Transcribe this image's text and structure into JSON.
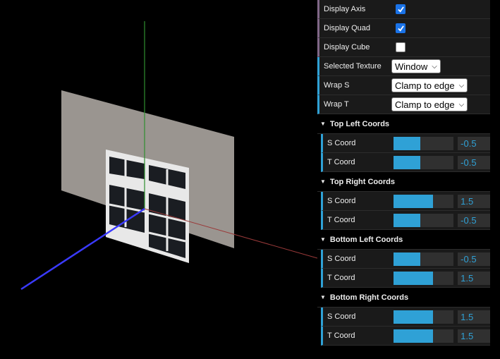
{
  "gui": {
    "controls": [
      {
        "label": "Display Axis",
        "checked": true
      },
      {
        "label": "Display Quad",
        "checked": true
      },
      {
        "label": "Display Cube",
        "checked": false
      }
    ],
    "selected_texture": {
      "label": "Selected Texture",
      "value": "Window"
    },
    "wrap_s": {
      "label": "Wrap S",
      "value": "Clamp to edge"
    },
    "wrap_t": {
      "label": "Wrap T",
      "value": "Clamp to edge"
    },
    "folders": [
      {
        "title": "Top Left Coords",
        "s": {
          "label": "S Coord",
          "value": "-0.5",
          "level": 0.45
        },
        "t": {
          "label": "T Coord",
          "value": "-0.5",
          "level": 0.45
        }
      },
      {
        "title": "Top Right Coords",
        "s": {
          "label": "S Coord",
          "value": "1.5",
          "level": 0.66
        },
        "t": {
          "label": "T Coord",
          "value": "-0.5",
          "level": 0.45
        }
      },
      {
        "title": "Bottom Left Coords",
        "s": {
          "label": "S Coord",
          "value": "-0.5",
          "level": 0.45
        },
        "t": {
          "label": "T Coord",
          "value": "1.5",
          "level": 0.66
        }
      },
      {
        "title": "Bottom Right Coords",
        "s": {
          "label": "S Coord",
          "value": "1.5",
          "level": 0.66
        },
        "t": {
          "label": "T Coord",
          "value": "1.5",
          "level": 0.66
        }
      }
    ]
  },
  "colors": {
    "slider_fill": "#2fa1d6",
    "axis_x": "#b03a3a",
    "axis_y": "#2f8f2f",
    "axis_z": "#3a3aff"
  }
}
